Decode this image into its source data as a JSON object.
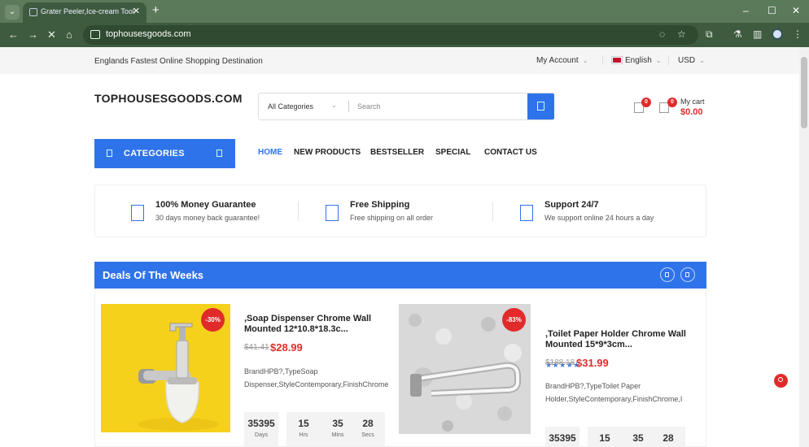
{
  "browser": {
    "tab_title": "Grater Peeler,Ice-cream Tool,Sp",
    "url": "tophousesgoods.com"
  },
  "topbar": {
    "tagline": "Englands Fastest Online Shopping Destination",
    "account": "My Account",
    "language": "English",
    "currency": "USD"
  },
  "header": {
    "logo": "TOPHOUSESGOODS.COM",
    "category_select": "All Categories",
    "search_placeholder": "Search",
    "wishlist_count": "0",
    "cart_count": "0",
    "cart_label": "My cart",
    "cart_total": "$0.00"
  },
  "nav": {
    "categories_label": "CATEGORIES",
    "items": [
      "HOME",
      "NEW PRODUCTS",
      "BESTSELLER",
      "SPECIAL",
      "CONTACT US"
    ]
  },
  "features": [
    {
      "title": "100% Money Guarantee",
      "subtitle": "30 days money back guarantee!"
    },
    {
      "title": "Free Shipping",
      "subtitle": "Free shipping on all order"
    },
    {
      "title": "Support 24/7",
      "subtitle": "We support online 24 hours a day"
    }
  ],
  "deals": {
    "title": "Deals Of The Weeks",
    "products": [
      {
        "discount": "-30%",
        "name": ",Soap Dispenser Chrome Wall Mounted 12*10.8*18.3c...",
        "old_price": "$41.41",
        "price": "$28.99",
        "desc_line1": "BrandHPB?,TypeSoap",
        "desc_line2": "Dispenser,StyleContemporary,FinishChrome",
        "countdown": [
          {
            "value": "35395",
            "unit": "Days"
          },
          {
            "value": "15",
            "unit": "Hrs"
          },
          {
            "value": "35",
            "unit": "Mins"
          },
          {
            "value": "28",
            "unit": "Secs"
          }
        ]
      },
      {
        "discount": "-83%",
        "stars": "★★★★★",
        "name": ",Toilet Paper Holder Chrome Wall Mounted 15*9*3cm...",
        "old_price": "$188.18",
        "price": "$31.99",
        "desc_line1": "BrandHPB?,TypeToilet Paper",
        "desc_line2": "Holder,StyleContemporary,FinishChrome,I",
        "countdown": [
          {
            "value": "35395",
            "unit": ""
          },
          {
            "value": "15",
            "unit": ""
          },
          {
            "value": "35",
            "unit": ""
          },
          {
            "value": "28",
            "unit": ""
          }
        ]
      }
    ]
  },
  "colors": {
    "accent": "#2f73ea",
    "sale": "#e12b2b",
    "browser_frame": "#3e5b3f"
  }
}
